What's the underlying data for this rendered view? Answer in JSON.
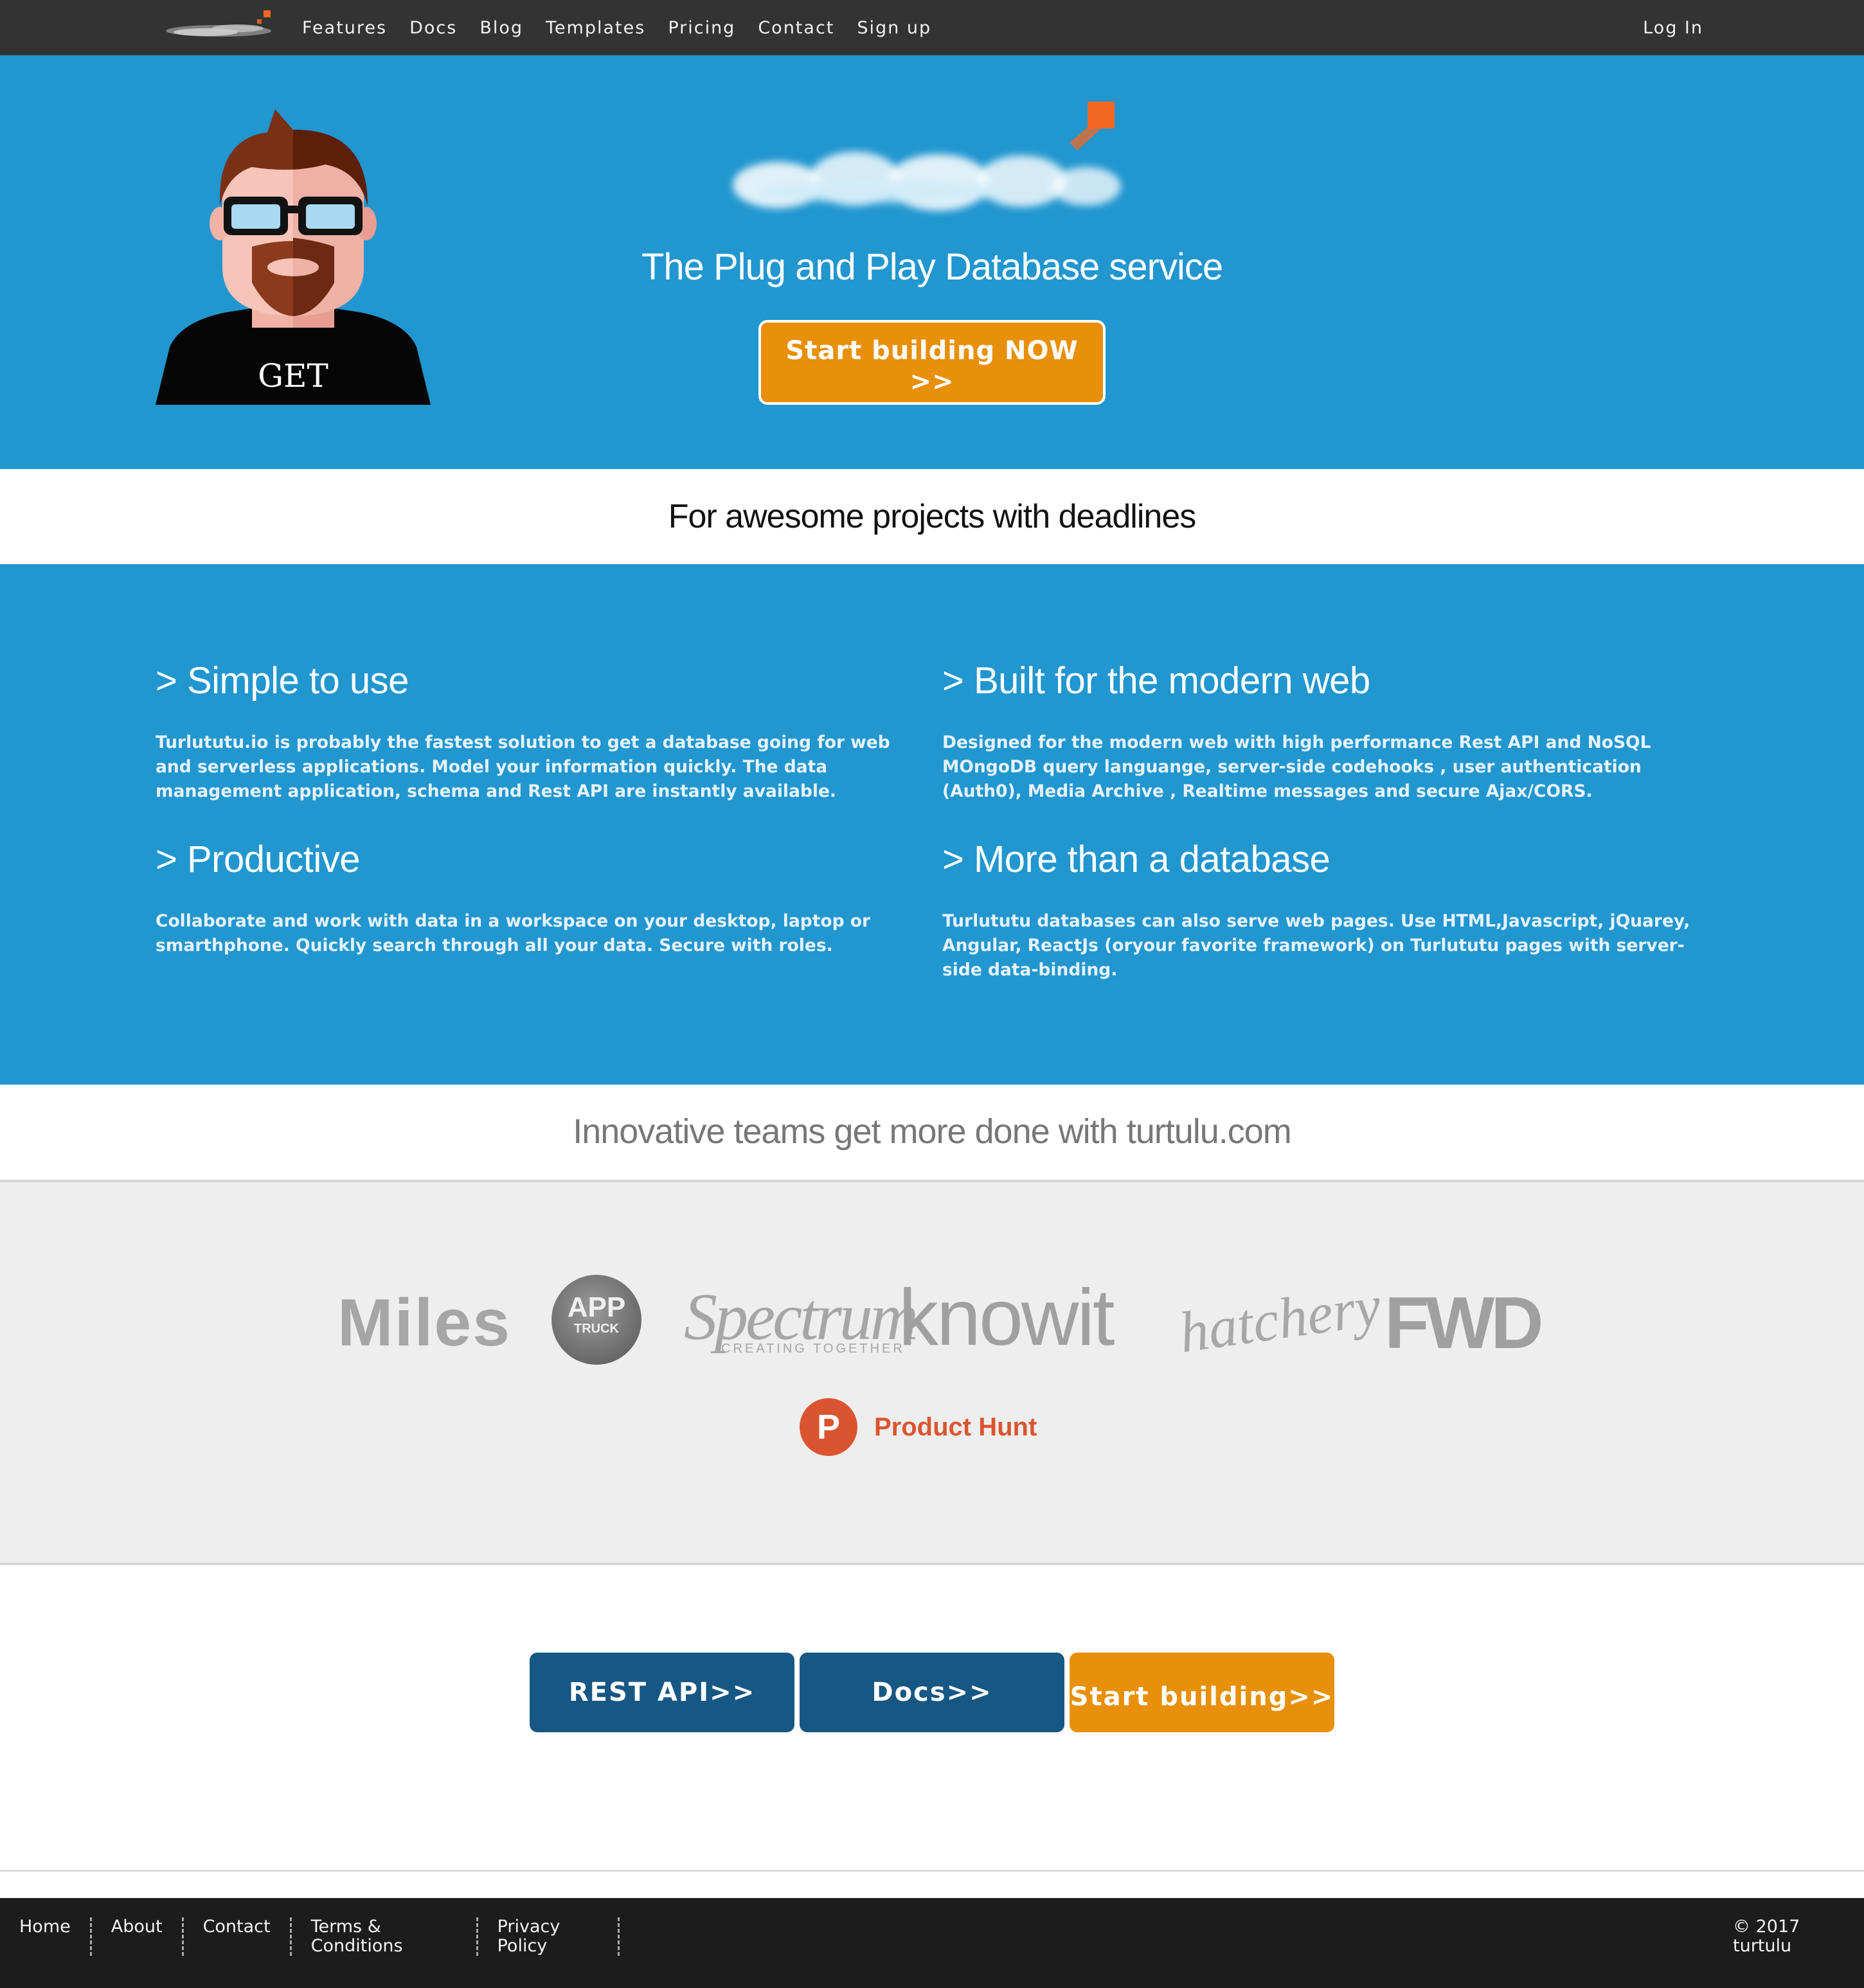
{
  "navbar": {
    "links": [
      "Features",
      "Docs",
      "Blog",
      "Templates",
      "Pricing",
      "Contact",
      "Sign up"
    ],
    "login": "Log In"
  },
  "hero": {
    "avatar_shirt_text": "GET",
    "subtitle": "The Plug and Play Database service",
    "cta": "Start building NOW >>"
  },
  "tagline": "For awesome projects with deadlines",
  "features": [
    {
      "title": "> Simple to use",
      "body": "Turlututu.io is probably the fastest solution to get a database going for web and serverless applications. Model your information quickly. The data management application, schema and Rest API are instantly available."
    },
    {
      "title": "> Built for the modern web",
      "body": "Designed for the modern web with high performance Rest API and NoSQL MOngoDB query languange, server-side codehooks , user authentication (Auth0), Media Archive , Realtime messages and secure Ajax/CORS."
    },
    {
      "title": "> Productive",
      "body": "Collaborate and work with data in a workspace on your desktop, laptop or smarthphone. Quickly search through all your data. Secure with roles."
    },
    {
      "title": "> More than a database",
      "body": "Turlututu databases can also serve web pages. Use HTML,Javascript, jQuarey, Angular, ReactJs (oryour favorite framework) on Turlututu pages with server-side data-binding."
    }
  ],
  "teams_heading": "Innovative teams get more done with turtulu.com",
  "customer_logos": {
    "miles": "Miles",
    "apptruck": "APP",
    "apptruck_sub": "TRUCK",
    "spectrum": "Spectrum",
    "spectrum_sub": "CREATING TOGETHER",
    "knowit": "knowit",
    "hatchery": "hatchery",
    "fwd": "FWD",
    "producthunt_badge": "P",
    "producthunt": "Product Hunt"
  },
  "cta_buttons": {
    "rest_api": "REST API>>",
    "docs": "Docs>>",
    "start": "Start building>>"
  },
  "footer": {
    "links": [
      "Home",
      "About",
      "Contact",
      "Terms & Conditions",
      "Privacy Policy"
    ],
    "copyright": "© 2017 turtulu"
  },
  "colors": {
    "navbar": "#333333",
    "primary_blue": "#2196cf",
    "accent_orange": "#e8900a",
    "dark_blue_button": "#175784",
    "footer": "#1c1c1c",
    "producthunt_red": "#da552f"
  }
}
